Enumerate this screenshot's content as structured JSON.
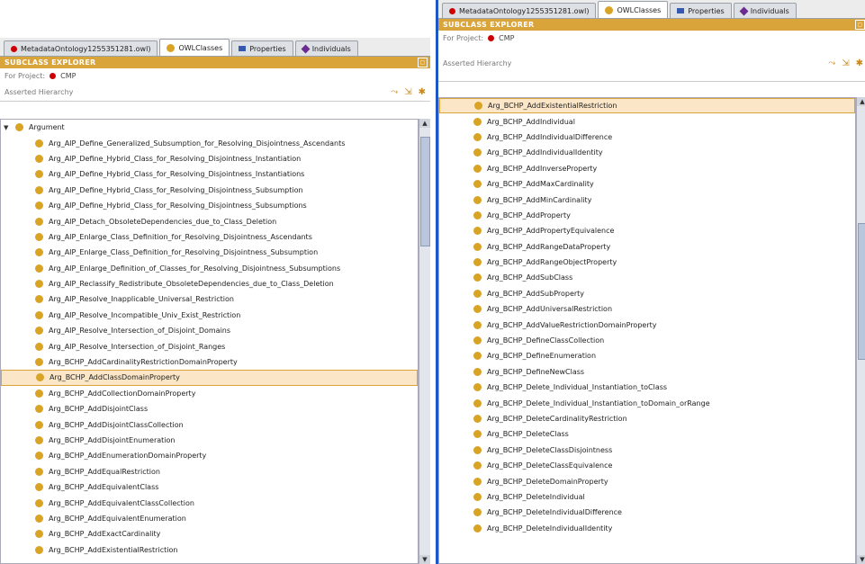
{
  "tabs": [
    {
      "label": "MetadataOntology1255351281.owl)",
      "icon": "red-dot-icon"
    },
    {
      "label": "OWLClasses",
      "icon": "owl-class-icon"
    },
    {
      "label": "Properties",
      "icon": "properties-icon"
    },
    {
      "label": "Individuals",
      "icon": "individuals-icon"
    }
  ],
  "right_tabs": [
    {
      "label": "MetadataOntology1255351281.owl)"
    },
    {
      "label": "OWLClasses"
    },
    {
      "label": "Properties"
    },
    {
      "label": "Individuals"
    }
  ],
  "header": "SUBCLASS EXPLORER",
  "project_label": "For Project:",
  "project_name": "CMP",
  "hierarchy_label": "Asserted Hierarchy",
  "colors": {
    "header": "#d9a43a",
    "class_dot": "#d9a326",
    "selection": "#fbe6c7",
    "divider": "#1e56c6"
  },
  "left_tree": {
    "root": "Argument",
    "items": [
      "Arg_AIP_Define_Generalized_Subsumption_for_Resolving_Disjointness_Ascendants",
      "Arg_AIP_Define_Hybrid_Class_for_Resolving_Disjointness_Instantiation",
      "Arg_AIP_Define_Hybrid_Class_for_Resolving_Disjointness_Instantiations",
      "Arg_AIP_Define_Hybrid_Class_for_Resolving_Disjointness_Subsumption",
      "Arg_AIP_Define_Hybrid_Class_for_Resolving_Disjointness_Subsumptions",
      "Arg_AIP_Detach_ObsoleteDependencies_due_to_Class_Deletion",
      "Arg_AIP_Enlarge_Class_Definition_for_Resolving_Disjointness_Ascendants",
      "Arg_AIP_Enlarge_Class_Definition_for_Resolving_Disjointness_Subsumption",
      "Arg_AIP_Enlarge_Definition_of_Classes_for_Resolving_Disjointness_Subsumptions",
      "Arg_AIP_Reclassify_Redistribute_ObsoleteDependencies_due_to_Class_Deletion",
      "Arg_AIP_Resolve_Inapplicable_Universal_Restriction",
      "Arg_AIP_Resolve_Incompatible_Univ_Exist_Restriction",
      "Arg_AIP_Resolve_Intersection_of_Disjoint_Domains",
      "Arg_AIP_Resolve_Intersection_of_Disjoint_Ranges",
      "Arg_BCHP_AddCardinalityRestrictionDomainProperty",
      "Arg_BCHP_AddClassDomainProperty",
      "Arg_BCHP_AddCollectionDomainProperty",
      "Arg_BCHP_AddDisjointClass",
      "Arg_BCHP_AddDisjointClassCollection",
      "Arg_BCHP_AddDisjointEnumeration",
      "Arg_BCHP_AddEnumerationDomainProperty",
      "Arg_BCHP_AddEqualRestriction",
      "Arg_BCHP_AddEquivalentClass",
      "Arg_BCHP_AddEquivalentClassCollection",
      "Arg_BCHP_AddEquivalentEnumeration",
      "Arg_BCHP_AddExactCardinality",
      "Arg_BCHP_AddExistentialRestriction"
    ],
    "selected_index": 15
  },
  "right_tree": {
    "items": [
      "Arg_BCHP_AddExistentialRestriction",
      "Arg_BCHP_AddIndividual",
      "Arg_BCHP_AddIndividualDifference",
      "Arg_BCHP_AddIndividualIdentity",
      "Arg_BCHP_AddInverseProperty",
      "Arg_BCHP_AddMaxCardinality",
      "Arg_BCHP_AddMinCardinality",
      "Arg_BCHP_AddProperty",
      "Arg_BCHP_AddPropertyEquivalence",
      "Arg_BCHP_AddRangeDataProperty",
      "Arg_BCHP_AddRangeObjectProperty",
      "Arg_BCHP_AddSubClass",
      "Arg_BCHP_AddSubProperty",
      "Arg_BCHP_AddUniversalRestriction",
      "Arg_BCHP_AddValueRestrictionDomainProperty",
      "Arg_BCHP_DefineClassCollection",
      "Arg_BCHP_DefineEnumeration",
      "Arg_BCHP_DefineNewClass",
      "Arg_BCHP_Delete_Individual_Instantiation_toClass",
      "Arg_BCHP_Delete_Individual_Instantiation_toDomain_orRange",
      "Arg_BCHP_DeleteCardinalityRestriction",
      "Arg_BCHP_DeleteClass",
      "Arg_BCHP_DeleteClassDisjointness",
      "Arg_BCHP_DeleteClassEquivalence",
      "Arg_BCHP_DeleteDomainProperty",
      "Arg_BCHP_DeleteIndividual",
      "Arg_BCHP_DeleteIndividualDifference",
      "Arg_BCHP_DeleteIndividualIdentity"
    ],
    "selected_index": 0
  }
}
